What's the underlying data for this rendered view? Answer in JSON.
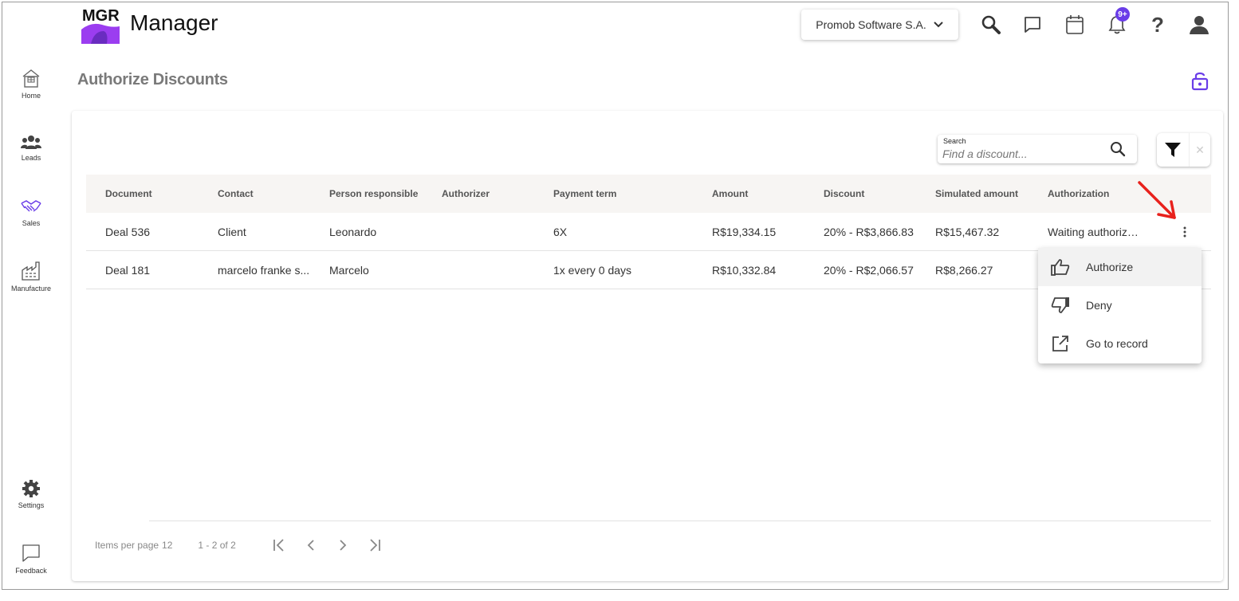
{
  "header": {
    "logo_text": "MGR",
    "app_title": "Manager",
    "company_selector": "Promob Software S.A.",
    "notifications_badge": "9+",
    "help_glyph": "?",
    "icons": [
      "search-icon",
      "chat-icon",
      "calendar-icon",
      "bell-icon",
      "help-icon",
      "user-icon"
    ]
  },
  "sidebar": {
    "items": [
      {
        "label": "Home",
        "icon": "home-icon"
      },
      {
        "label": "Leads",
        "icon": "people-icon"
      },
      {
        "label": "Sales",
        "icon": "handshake-icon"
      },
      {
        "label": "Manufacture",
        "icon": "factory-icon"
      },
      {
        "label": "Settings",
        "icon": "gear-icon"
      },
      {
        "label": "Feedback",
        "icon": "feedback-icon"
      }
    ]
  },
  "page": {
    "title": "Authorize Discounts"
  },
  "search": {
    "label": "Search",
    "placeholder": "Find a discount..."
  },
  "filter": {
    "clear_glyph": "✕"
  },
  "table": {
    "columns": [
      "Document",
      "Contact",
      "Person responsible",
      "Authorizer",
      "Payment term",
      "Amount",
      "Discount",
      "Simulated amount",
      "Authorization"
    ],
    "rows": [
      [
        "Deal 536",
        "Client",
        "Leonardo",
        "",
        "6X",
        "R$19,334.15",
        "20% - R$3,866.83",
        "R$15,467.32",
        "Waiting authorization"
      ],
      [
        "Deal 181",
        "marcelo franke s...",
        "Marcelo",
        "",
        "1x every 0 days",
        "R$10,332.84",
        "20% - R$2,066.57",
        "R$8,266.27",
        ""
      ]
    ]
  },
  "pagination": {
    "items_per_page_label": "Items per page",
    "items_per_page": "12",
    "range": "1 - 2 of 2"
  },
  "context_menu": {
    "items": [
      {
        "label": "Authorize",
        "icon": "thumbs-up-icon"
      },
      {
        "label": "Deny",
        "icon": "thumbs-down-icon"
      },
      {
        "label": "Go to record",
        "icon": "open-external-icon"
      }
    ]
  },
  "colors": {
    "accent": "#6a3de8",
    "logo_purple": "#9b3df0",
    "annotation_red": "#e8211c",
    "table_header_bg": "#f7f5f3"
  }
}
